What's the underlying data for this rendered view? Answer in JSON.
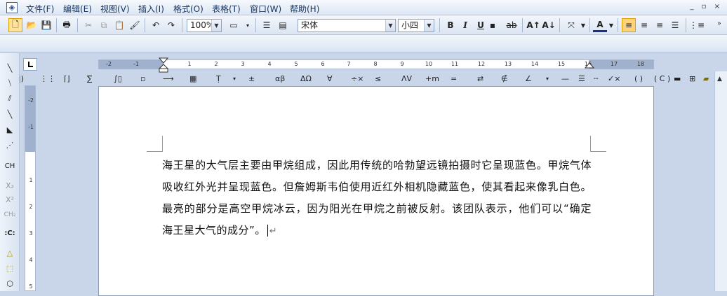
{
  "menu": {
    "items": [
      "文件(F)",
      "编辑(E)",
      "视图(V)",
      "插入(I)",
      "格式(O)",
      "表格(T)",
      "窗口(W)",
      "帮助(H)"
    ]
  },
  "toolbar": {
    "zoom": "100%",
    "font_name": "宋体",
    "font_size": "小四",
    "bold": "B",
    "italic": "I",
    "underline": "U"
  },
  "format_toolbar": {
    "symbols": [
      "(||)",
      "∑",
      "±",
      "αβ",
      "ΔΩ",
      "∀",
      "≤",
      "ΛV",
      "=",
      "⊥",
      "∠",
      "( )",
      "( C )"
    ]
  },
  "left_toolbar": {
    "ch": "CH",
    "sub": "X₂",
    "sup": "X²",
    "ch2": "CH₂",
    "colon": ":C:"
  },
  "ruler": {
    "h_labels": [
      "-2",
      "-1",
      "1",
      "2",
      "3",
      "4",
      "5",
      "6",
      "7",
      "8",
      "9",
      "10",
      "11",
      "12",
      "13",
      "14",
      "15",
      "16",
      "17",
      "18"
    ],
    "v_labels": [
      "-2",
      "-1",
      "1",
      "2",
      "3",
      "4",
      "5"
    ]
  },
  "document": {
    "text": "海王星的大气层主要由甲烷组成，因此用传统的哈勃望远镜拍摄时它呈现蓝色。甲烷气体吸收红外光并呈现蓝色。但詹姆斯韦伯使用近红外相机隐藏蓝色，使其看起来像乳白色。最亮的部分是高空甲烷冰云，因为阳光在甲烷之前被反射。该团队表示，他们可以“确定海王星大气的成分”。",
    "paragraph_mark": "↵"
  },
  "colors": {
    "chrome": "#dce6f4",
    "workspace": "#c9d6ea",
    "page": "#ffffff",
    "accent": "#f5a623"
  }
}
